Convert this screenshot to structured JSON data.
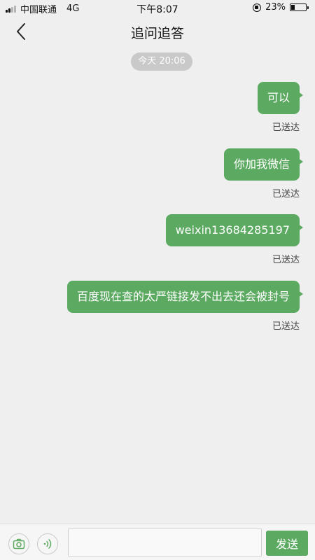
{
  "status_bar": {
    "carrier": "中国联通",
    "network": "4G",
    "time": "下午8:07",
    "battery": "23%"
  },
  "header": {
    "title": "追问追答"
  },
  "chat": {
    "timestamp": "今天 20:06",
    "messages": [
      {
        "text": "可以",
        "status": "已送达"
      },
      {
        "text": "你加我微信",
        "status": "已送达"
      },
      {
        "text": "weixin13684285197",
        "status": "已送达"
      },
      {
        "text": "百度现在查的太严链接发不出去还会被封号",
        "status": "已送达"
      }
    ]
  },
  "input_bar": {
    "placeholder": "",
    "send_label": "发送"
  },
  "colors": {
    "bubble": "#5caa61",
    "background": "#efefef",
    "accent": "#5caa61"
  },
  "icons": {
    "back": "chevron-left-icon",
    "camera": "camera-icon",
    "voice": "voice-wave-icon",
    "lock": "orientation-lock-icon",
    "battery": "battery-icon"
  }
}
